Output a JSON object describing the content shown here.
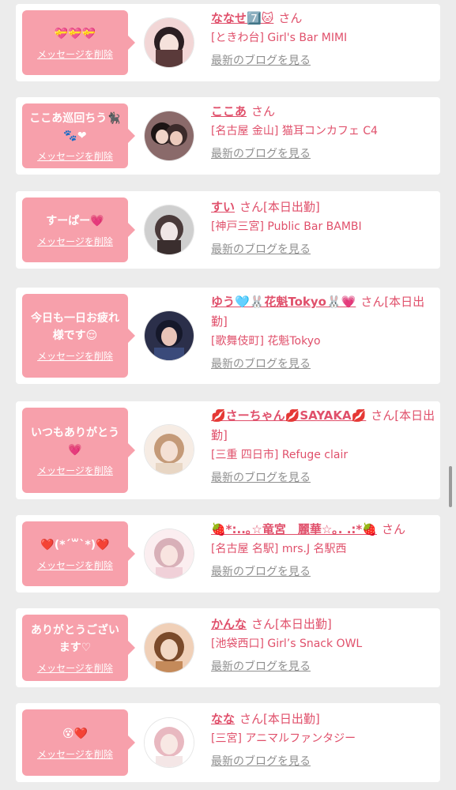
{
  "delete_label": "メッセージを削除",
  "blog_label": "最新のブログを見る",
  "cards": [
    {
      "message": "💝💝💝",
      "name": "ななせ7️⃣🐱",
      "suffix": "さん",
      "shop": "[ときわ台] Girl's Bar MIMI",
      "avatar_colors": [
        "#5a3a3a",
        "#f2d6d6",
        "#2a1e22"
      ]
    },
    {
      "message": "ここあ巡回ちう🐈‍⬛🐾❤",
      "name": "ここあ",
      "suffix": "さん",
      "shop": "[名古屋 金山] 猫耳コンカフェ C4",
      "avatar_colors": [
        "#3b2b2b",
        "#8a6a6a",
        "#1c1414"
      ]
    },
    {
      "message": "すーぱー💗",
      "name": "すい",
      "suffix": "さん[本日出勤]",
      "shop": "[神戸三宮] Public Bar BAMBI",
      "avatar_colors": [
        "#cfcfcf",
        "#4a3a3a",
        "#f0e6e6"
      ]
    },
    {
      "message": "今日も一日お疲れ様です😌",
      "name": "ゆう🩵🐰花魁Tokyo🐰💗",
      "suffix": "さん[本日出勤]",
      "shop": "[歌舞伎町] 花魁Tokyo",
      "avatar_colors": [
        "#2b2f4a",
        "#e8c4b8",
        "#15182a"
      ]
    },
    {
      "message": "いつもありがとう💗",
      "name": "💋さーちゃん💋SAYAKA💋",
      "suffix": "さん[本日出勤]",
      "shop": "[三重 四日市] Refuge clair",
      "avatar_colors": [
        "#e8d6c4",
        "#c49a78",
        "#f6ece4"
      ]
    },
    {
      "message": "❤️(*´꒳`*)❤️",
      "name": "🍓*:..｡☆竜宮　麗華☆｡. .:*🍓",
      "suffix": "さん",
      "shop": "[名古屋 名駅] mrs.J 名駅西",
      "avatar_colors": [
        "#f0d0d8",
        "#d8b0b8",
        "#fbeef0"
      ]
    },
    {
      "message": "ありがとうございます♡",
      "name": "かんな",
      "suffix": "さん[本日出勤]",
      "shop": "[池袋西口] Girl’s Snack OWL",
      "avatar_colors": [
        "#c48a5a",
        "#f0d0b8",
        "#7a4a2a"
      ]
    },
    {
      "message": "😵❤️",
      "name": "なな",
      "suffix": "さん[本日出勤]",
      "shop": "[三宮] アニマルファンタジー",
      "avatar_colors": [
        "#f4e6e6",
        "#e8b8c0",
        "#ffffff"
      ]
    }
  ]
}
